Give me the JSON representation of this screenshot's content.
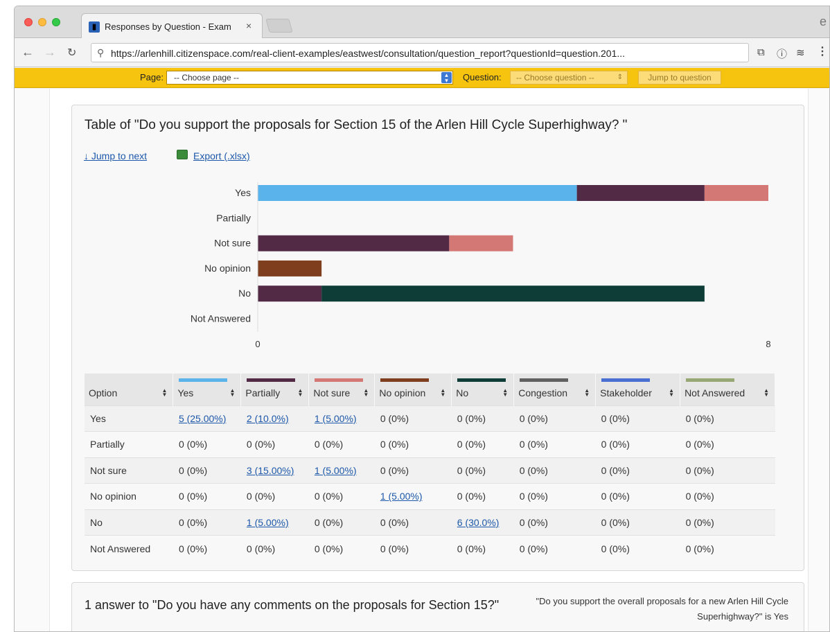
{
  "browser": {
    "tab_title": "Responses by Question - Exam",
    "tab_close": "×",
    "url": "https://arlenhill.citizenspace.com/real-client-examples/eastwest/consultation/question_report?questionId=question.201...",
    "profile_glyph": "e"
  },
  "toolbar": {
    "page_label": "Page:",
    "page_select_value": "-- Choose page --",
    "question_label": "Question:",
    "question_select_value": "-- Choose question --",
    "jump_button": "Jump to question"
  },
  "panel": {
    "title": "Table of \"Do you support the proposals for Section 15 of the Arlen Hill Cycle Superhighway? \"",
    "jump_next": "↓ Jump to next",
    "export": "Export (.xlsx)"
  },
  "colors": {
    "Yes": "#5ab4eb",
    "Partially": "#522a46",
    "Not sure": "#d47876",
    "No opinion": "#7f3f1f",
    "No": "#0e3d38",
    "Congestion": "#616161",
    "Stakeholder": "#4a6fd3",
    "Not Answered": "#97a874"
  },
  "chart_data": {
    "type": "bar",
    "orientation": "horizontal",
    "stacked": true,
    "categories": [
      "Yes",
      "Partially",
      "Not sure",
      "No opinion",
      "No",
      "Not Answered"
    ],
    "series": [
      {
        "name": "Yes",
        "values": [
          5,
          0,
          0,
          0,
          0,
          0
        ]
      },
      {
        "name": "Partially",
        "values": [
          2,
          0,
          3,
          0,
          1,
          0
        ]
      },
      {
        "name": "Not sure",
        "values": [
          1,
          0,
          1,
          0,
          0,
          0
        ]
      },
      {
        "name": "No opinion",
        "values": [
          0,
          0,
          0,
          1,
          0,
          0
        ]
      },
      {
        "name": "No",
        "values": [
          0,
          0,
          0,
          0,
          6,
          0
        ]
      },
      {
        "name": "Congestion",
        "values": [
          0,
          0,
          0,
          0,
          0,
          0
        ]
      },
      {
        "name": "Stakeholder",
        "values": [
          0,
          0,
          0,
          0,
          0,
          0
        ]
      },
      {
        "name": "Not Answered",
        "values": [
          0,
          0,
          0,
          0,
          0,
          0
        ]
      }
    ],
    "xlim": [
      0,
      8
    ],
    "tick_labels": [
      "0",
      "8"
    ],
    "grid": false
  },
  "table": {
    "headers": [
      "Option",
      "Yes",
      "Partially",
      "Not sure",
      "No opinion",
      "No",
      "Congestion",
      "Stakeholder",
      "Not Answered"
    ],
    "rows": [
      [
        "Yes",
        "5 (25.00%)",
        "2 (10.0%)",
        "1 (5.00%)",
        "0 (0%)",
        "0 (0%)",
        "0 (0%)",
        "0 (0%)",
        "0 (0%)"
      ],
      [
        "Partially",
        "0 (0%)",
        "0 (0%)",
        "0 (0%)",
        "0 (0%)",
        "0 (0%)",
        "0 (0%)",
        "0 (0%)",
        "0 (0%)"
      ],
      [
        "Not sure",
        "0 (0%)",
        "3 (15.00%)",
        "1 (5.00%)",
        "0 (0%)",
        "0 (0%)",
        "0 (0%)",
        "0 (0%)",
        "0 (0%)"
      ],
      [
        "No opinion",
        "0 (0%)",
        "0 (0%)",
        "0 (0%)",
        "1 (5.00%)",
        "0 (0%)",
        "0 (0%)",
        "0 (0%)",
        "0 (0%)"
      ],
      [
        "No",
        "0 (0%)",
        "1 (5.00%)",
        "0 (0%)",
        "0 (0%)",
        "6 (30.0%)",
        "0 (0%)",
        "0 (0%)",
        "0 (0%)"
      ],
      [
        "Not Answered",
        "0 (0%)",
        "0 (0%)",
        "0 (0%)",
        "0 (0%)",
        "0 (0%)",
        "0 (0%)",
        "0 (0%)",
        "0 (0%)"
      ]
    ]
  },
  "panel2": {
    "title": "1 answer to \"Do you have any comments on the proposals for Section 15?\"",
    "filter": "\"Do you support the overall proposals for a new Arlen Hill Cycle Superhighway?\" is Yes"
  }
}
